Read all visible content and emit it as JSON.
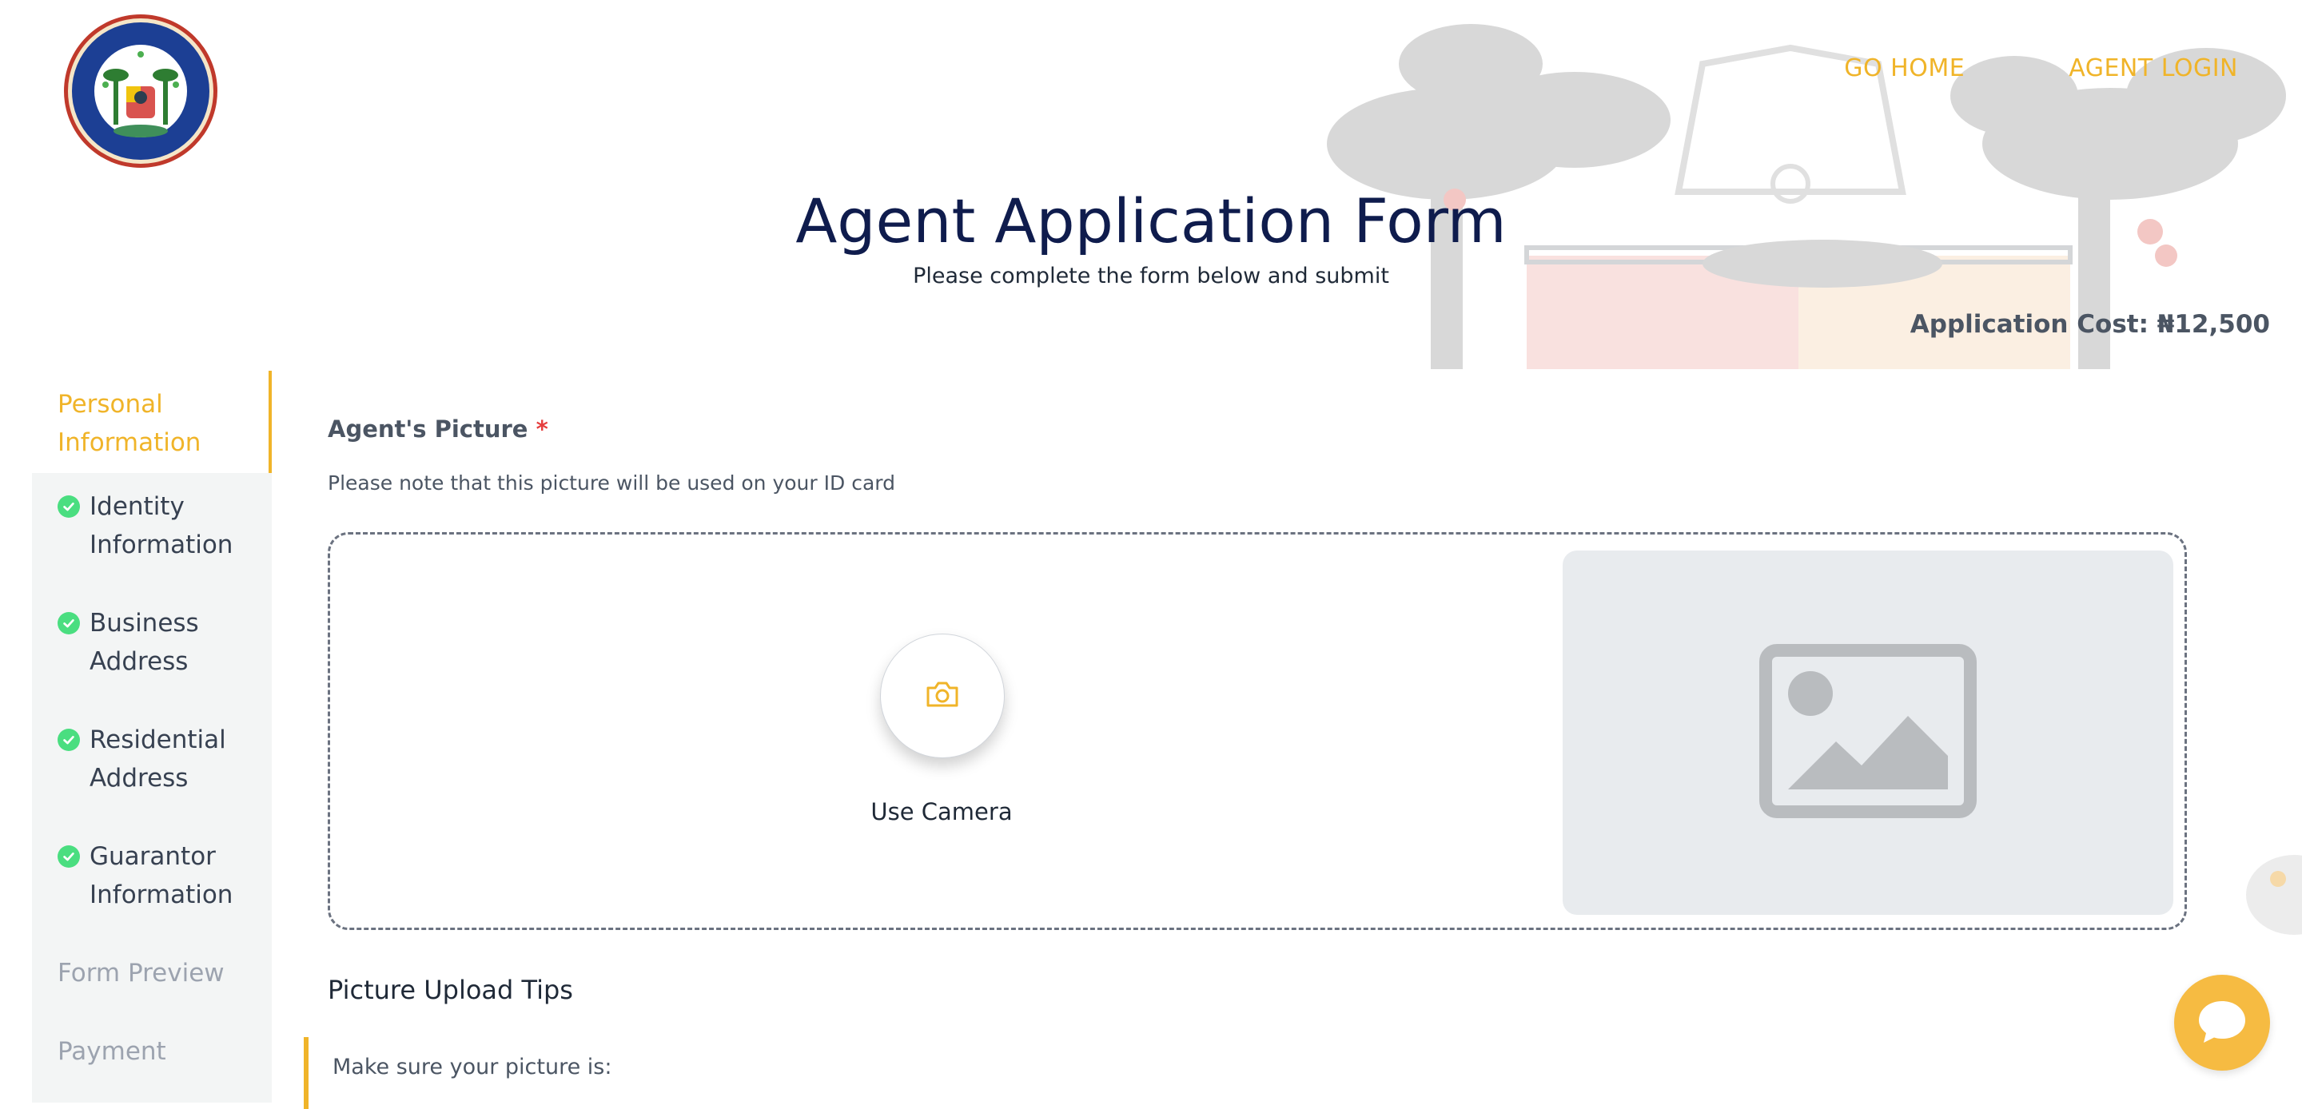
{
  "header": {
    "logo_alt": "LAGOS STATE LOTTERIES AND GAMING AUTHORITY",
    "nav": {
      "go_home": "GO HOME",
      "agent_login": "AGENT LOGIN"
    }
  },
  "page": {
    "title": "Agent Application Form",
    "subtitle": "Please complete the form below and submit",
    "application_cost": "Application Cost: ₦12,500"
  },
  "sidebar": {
    "items": [
      {
        "label_line1": "Personal",
        "label_line2": "Information",
        "state": "active"
      },
      {
        "label_line1": "Identity",
        "label_line2": "Information",
        "state": "done"
      },
      {
        "label_line1": "Business",
        "label_line2": "Address",
        "state": "done"
      },
      {
        "label_line1": "Residential",
        "label_line2": "Address",
        "state": "done"
      },
      {
        "label_line1": "Guarantor",
        "label_line2": "Information",
        "state": "done"
      },
      {
        "label_line1": "Form Preview",
        "state": "pending"
      },
      {
        "label_line1": "Payment",
        "state": "pending"
      }
    ]
  },
  "form": {
    "picture_label": "Agent's Picture",
    "required_mark": "*",
    "picture_note": "Please note that this picture will be used on your ID card",
    "camera_label": "Use Camera",
    "tips_title": "Picture Upload Tips",
    "tips_intro": "Make sure your picture is:"
  },
  "icons": {
    "camera": "camera-icon",
    "image_placeholder": "image-placeholder-icon",
    "check": "check-circle-icon",
    "chat": "chat-icon"
  },
  "colors": {
    "accent": "#f0b429",
    "title": "#0f1c4d",
    "success": "#4ade80",
    "required": "#e53e3e"
  }
}
